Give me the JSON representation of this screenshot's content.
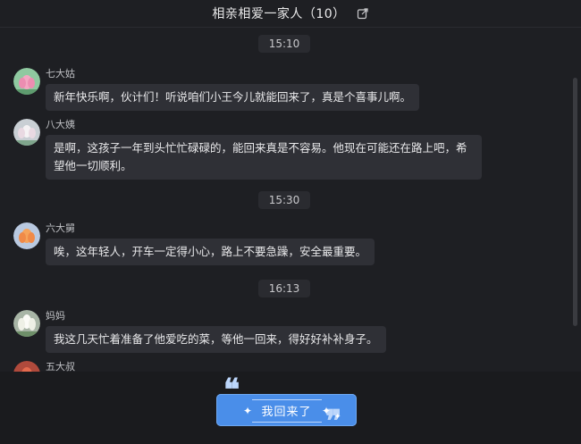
{
  "header": {
    "title": "相亲相爱一家人（10）",
    "share_icon": "share-icon"
  },
  "timestamps": [
    "15:10",
    "15:30",
    "16:13"
  ],
  "messages": [
    {
      "name": "七大姑",
      "text": "新年快乐啊，伙计们！听说咱们小王今儿就能回来了，真是个喜事儿啊。"
    },
    {
      "name": "八大姨",
      "text": "是啊，这孩子一年到头忙忙碌碌的，能回来真是不容易。他现在可能还在路上吧，希望他一切顺利。"
    },
    {
      "name": "六大舅",
      "text": "唉，这年轻人，开车一定得小心，路上不要急躁，安全最重要。"
    },
    {
      "name": "妈妈",
      "text": "我这几天忙着准备了他爱吃的菜，等他一回来，得好好补补身子。"
    },
    {
      "name": "五大叔",
      "text": ""
    }
  ],
  "footer": {
    "button_label": "我回来了"
  },
  "colors": {
    "background": "#1e1f23",
    "bubble": "#2f3036",
    "accent": "#4a8ee9"
  }
}
